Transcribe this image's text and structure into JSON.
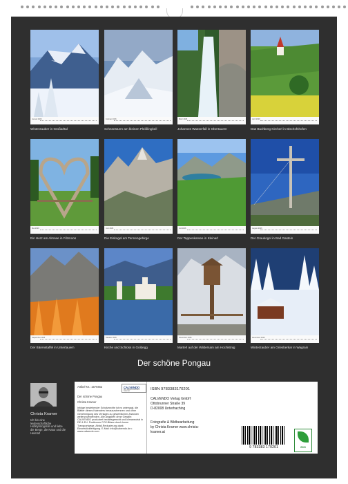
{
  "months": [
    {
      "caption": "Winterzauber in Großarltal",
      "month_label": "Januar 2026",
      "scene": "winter-mountain"
    },
    {
      "caption": "Schneesturm am kleinen Pleißlingkeil",
      "month_label": "Februar 2026",
      "scene": "snow-peak"
    },
    {
      "caption": "Johannes Wasserfall in Obertauern",
      "month_label": "März 2026",
      "scene": "waterfall"
    },
    {
      "caption": "Das Buchberg Kircherl in Bischofshofen",
      "month_label": "April 2026",
      "scene": "chapel-meadow"
    },
    {
      "caption": "Ein Herz am Almsee in Filzmoos",
      "month_label": "Mai 2026",
      "scene": "wood-heart"
    },
    {
      "caption": "Die Eiskogel am Tennengebirge",
      "month_label": "Juni 2026",
      "scene": "rock-peaks"
    },
    {
      "caption": "Der Tappenkarsee in Kleinarl",
      "month_label": "Juli 2026",
      "scene": "alpine-lake"
    },
    {
      "caption": "Der Graukogel in Bad Gastein",
      "month_label": "August 2026",
      "scene": "summit-cross"
    },
    {
      "caption": "Der Bärenstaffel in Untertauern",
      "month_label": "September 2026",
      "scene": "autumn-forest"
    },
    {
      "caption": "Kirche und Schloss in Goldegg",
      "month_label": "Oktober 2026",
      "scene": "castle-lake"
    },
    {
      "caption": "Marterl auf der Wildersam am Hochkönig",
      "month_label": "November 2026",
      "scene": "wayside-shrine"
    },
    {
      "caption": "Winterzauber am Griesberkar in Wagrain",
      "month_label": "Dezember 2026",
      "scene": "winter-hut"
    }
  ],
  "title": "Der schöne Pongau",
  "author": {
    "name": "Christa Kramer",
    "bio": "Ich bin eine leidenschaftliche Hobbyfotografin und liebe die Berge, die Natur und die Heimat!"
  },
  "info": {
    "article_no": "Artikel-Nr.: 1579462",
    "calvendo_logo": "CALVENDO",
    "calvendo_tag": "Wir machen aus Fotos Kalender",
    "product_title": "Der schöne Pongau",
    "author_line": "Christa Kramer",
    "legal_text": "Infolge bestehender Schutzrechte ist es untersagt, die Blätter dieses Kalenders herauszutrennen und ohne Genehmigung des Verlages zu gewerblichen Zwecken weiterzuverwenden. Alle Angaben ohne Gewähr. CALVENDO produziert bedarfsgerecht und klimaneutral in DE & EU. Postboxes CO2-Bilanz durch kurze Transportwege. Abfall-Reduzierung dank Einzelstückfertigung. E-Mail: info@calvendo.de • www.calvendo.com",
    "isbn": "ISBN 9783383170201",
    "publisher": "CALVENDO Verlag GmbH",
    "street": "Ottobrunner Straße 39",
    "city": "D-82008 Unterhaching",
    "credit_1": "Fotografie & Bildbearbeitung",
    "credit_2": "by Christa Kramer www.christa-",
    "credit_3": "kramer.at",
    "barcode_number": "9 783383 170201",
    "eco_label": "eco"
  }
}
